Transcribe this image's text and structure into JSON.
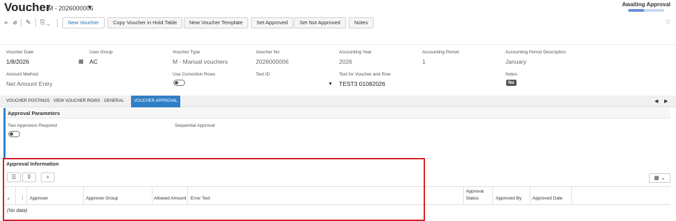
{
  "header": {
    "title": "Voucher",
    "voucher_id": "M - 2026000006",
    "status": "Awaiting Approval",
    "status_progress": 0.45
  },
  "toolbar": {
    "new_voucher": "New Voucher",
    "copy_hold": "Copy Voucher in Hold Table",
    "new_template": "New Voucher Template",
    "set_approved": "Set Approved",
    "set_not_approved": "Set Not Approved",
    "notes": "Notes"
  },
  "form": {
    "voucher_date": {
      "label": "Voucher Date",
      "value": "1/8/2026"
    },
    "user_group": {
      "label": "User Group",
      "value": "AC"
    },
    "voucher_type": {
      "label": "Voucher Type",
      "value": "M - Manual vouchers"
    },
    "voucher_no": {
      "label": "Voucher No",
      "value": "2026000006"
    },
    "accounting_year": {
      "label": "Accounting Year",
      "value": "2026"
    },
    "accounting_period": {
      "label": "Accounting Period",
      "value": "1"
    },
    "period_desc": {
      "label": "Accounting Period Description",
      "value": "January"
    },
    "amount_method": {
      "label": "Amount Method",
      "value": "Net Amount Entry"
    },
    "use_correction": {
      "label": "Use Correction Rows"
    },
    "text_id": {
      "label": "Text ID",
      "value": ""
    },
    "text_voucher_row": {
      "label": "Text for Voucher and Row",
      "value": "TEST3 01082026"
    },
    "notes": {
      "label": "Notes",
      "value": "No"
    }
  },
  "tabs": [
    {
      "label": "VOUCHER POSTINGS"
    },
    {
      "label": "VIEW VOUCHER ROWS"
    },
    {
      "label": "GENERAL"
    },
    {
      "label": "VOUCHER APPROVAL"
    }
  ],
  "approval_params": {
    "title": "Approval Parameters",
    "two_approvers": "Two Approvers Required",
    "sequential": "Sequential Approval"
  },
  "approval_info": {
    "title": "Approval Information",
    "columns": [
      "Approver",
      "Approver Group",
      "Allowed Amount",
      "Error Text",
      "Approval Status",
      "Approved By",
      "Approved Date"
    ],
    "status_line1": "Approval",
    "status_line2": "Status",
    "no_data": "(No data)"
  }
}
